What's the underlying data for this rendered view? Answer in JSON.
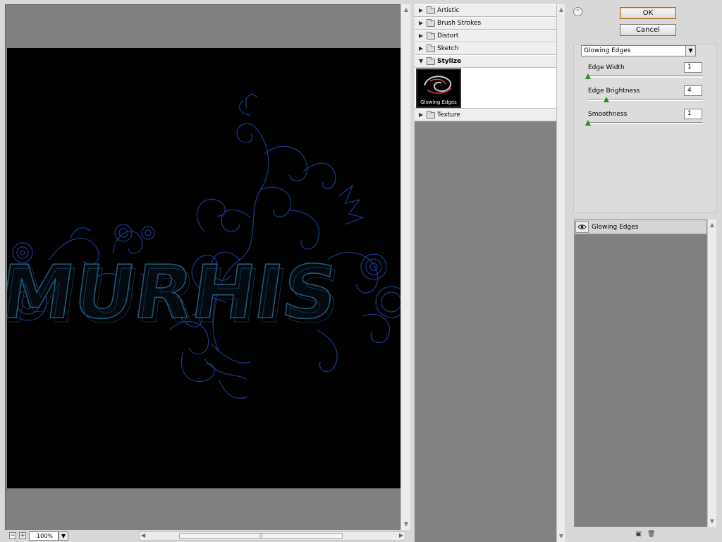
{
  "preview": {
    "canvas_text": "MURHIS",
    "zoom": "100%",
    "zoom_out": "−",
    "zoom_in": "+"
  },
  "filter_categories": [
    {
      "label": "Artistic",
      "open": false
    },
    {
      "label": "Brush Strokes",
      "open": false
    },
    {
      "label": "Distort",
      "open": false
    },
    {
      "label": "Sketch",
      "open": false
    },
    {
      "label": "Stylize",
      "open": true
    },
    {
      "label": "Texture",
      "open": false
    }
  ],
  "stylize_thumb": {
    "label": "Glowing Edges"
  },
  "buttons": {
    "ok": "OK",
    "cancel": "Cancel"
  },
  "settings": {
    "selected_filter": "Glowing Edges",
    "params": [
      {
        "label": "Edge Width",
        "value": "1",
        "level": 0.0
      },
      {
        "label": "Edge Brightness",
        "value": "4",
        "level": 0.16
      },
      {
        "label": "Smoothness",
        "value": "1",
        "level": 0.0
      }
    ]
  },
  "layers": {
    "items": [
      {
        "label": "Glowing Edges"
      }
    ]
  },
  "colors": {
    "glow_blue": "#1a3a8c",
    "text_glow": "#1d5a7a",
    "ok_border": "#a06a28"
  },
  "icons": {
    "collapse": "double-chevron-up-icon",
    "eye": "eye-icon",
    "new_layer": "new-layer-icon",
    "delete_layer": "trash-icon"
  }
}
